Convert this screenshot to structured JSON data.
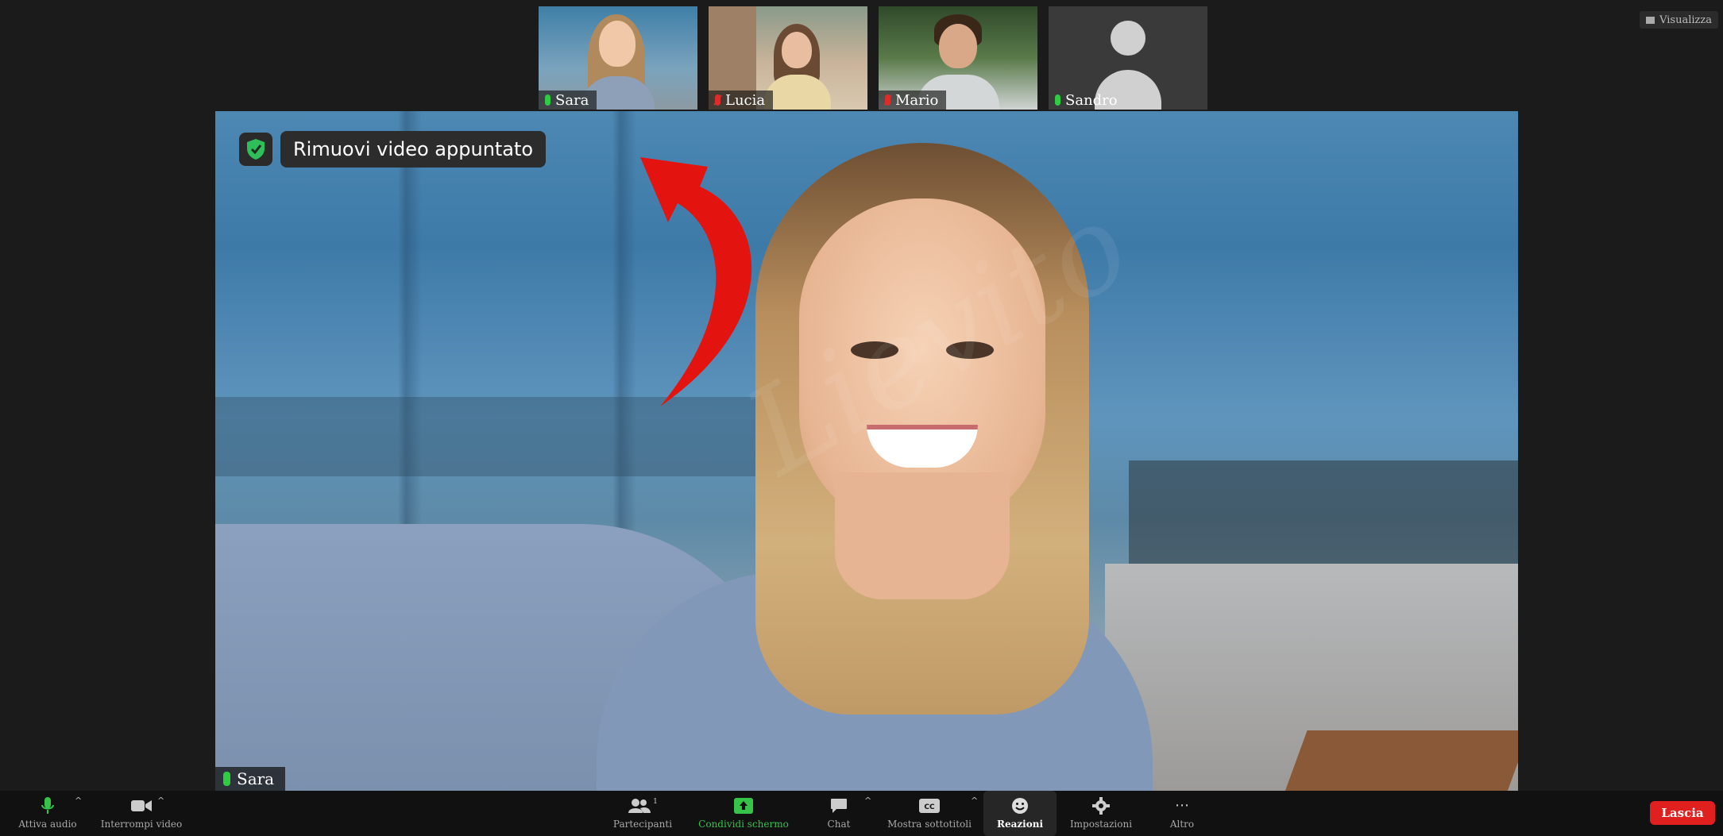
{
  "top": {
    "view_label": "Visualizza"
  },
  "thumbnails": [
    {
      "name": "Sara",
      "mic": "on"
    },
    {
      "name": "Lucia",
      "mic": "off"
    },
    {
      "name": "Mario",
      "mic": "off"
    },
    {
      "name": "Sandro",
      "mic": "on"
    }
  ],
  "main": {
    "pinned_label": "Rimuovi video appuntato",
    "speaker_name": "Sara"
  },
  "toolbar": {
    "audio": "Attiva audio",
    "video": "Interrompi video",
    "participants": "Partecipanti",
    "participants_count": "1",
    "share": "Condividi schermo",
    "chat": "Chat",
    "captions": "Mostra sottotitoli",
    "reactions": "Reazioni",
    "settings": "Impostazioni",
    "more": "Altro",
    "leave": "Lascia"
  },
  "colors": {
    "accent_green": "#37c24a",
    "leave_red": "#e0201f",
    "arrow_red": "#e3140f"
  }
}
